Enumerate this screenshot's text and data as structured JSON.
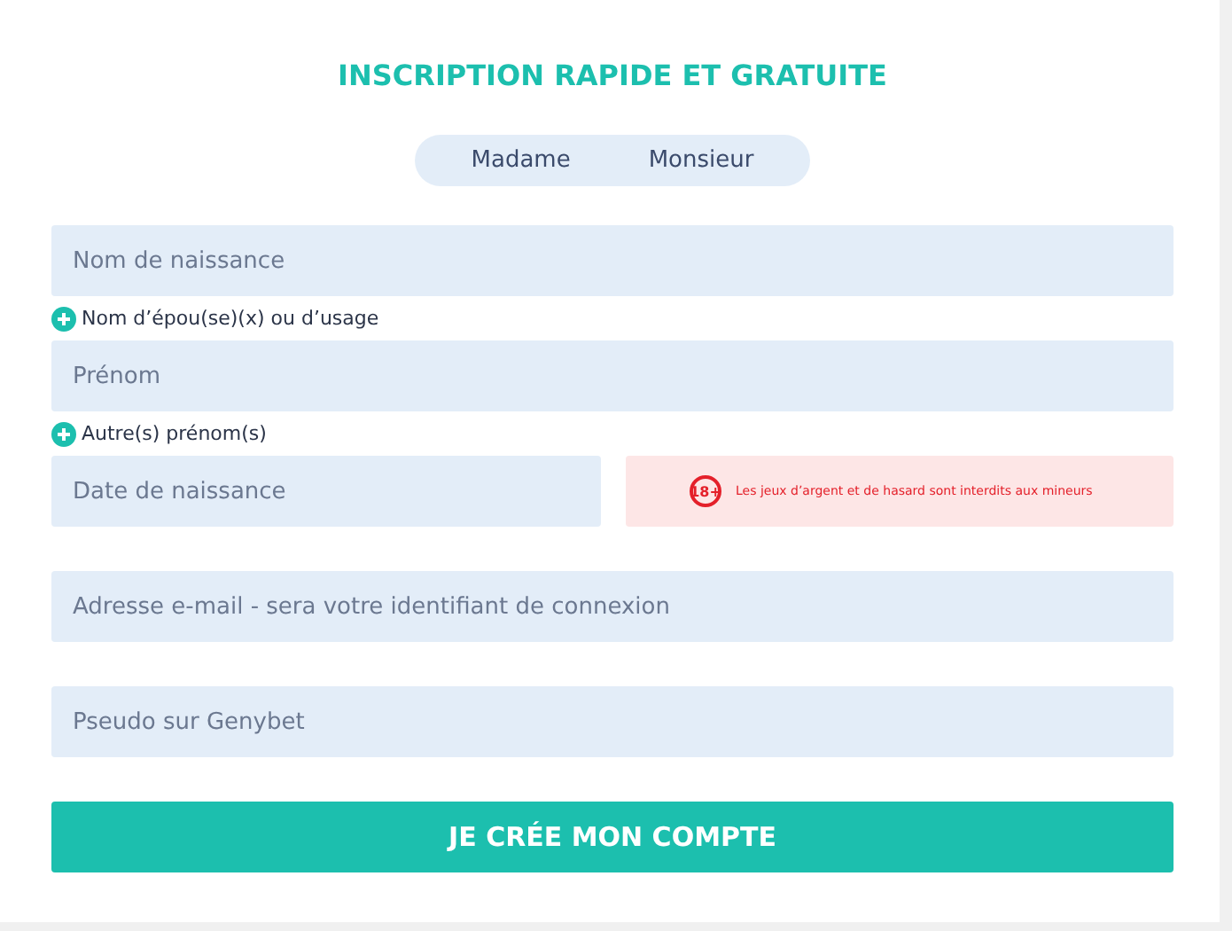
{
  "title": "INSCRIPTION RAPIDE ET GRATUITE",
  "gender_options": [
    {
      "label": "Madame",
      "selected": false
    },
    {
      "label": "Monsieur",
      "selected": false
    }
  ],
  "form_rows": [
    {
      "kind": "field",
      "placeholder": "Nom de naissance"
    },
    {
      "kind": "add_link",
      "label": "Nom d’épou(se)(x) ou d’usage"
    },
    {
      "kind": "field",
      "placeholder": "Prénom"
    },
    {
      "kind": "add_link",
      "label": "Autre(s) prénom(s)"
    },
    {
      "kind": "field_with_notice",
      "placeholder": "Date de naissance",
      "notice": {
        "badge": "18+",
        "text": "Les jeux d’argent et de hasard sont interdits aux mineurs"
      }
    },
    {
      "kind": "spacer"
    },
    {
      "kind": "field",
      "placeholder": "Adresse e-mail - sera votre identifiant de connexion"
    },
    {
      "kind": "spacer"
    },
    {
      "kind": "field",
      "placeholder": "Pseudo sur Genybet"
    }
  ],
  "submit_button": "JE CRÉE MON COMPTE"
}
